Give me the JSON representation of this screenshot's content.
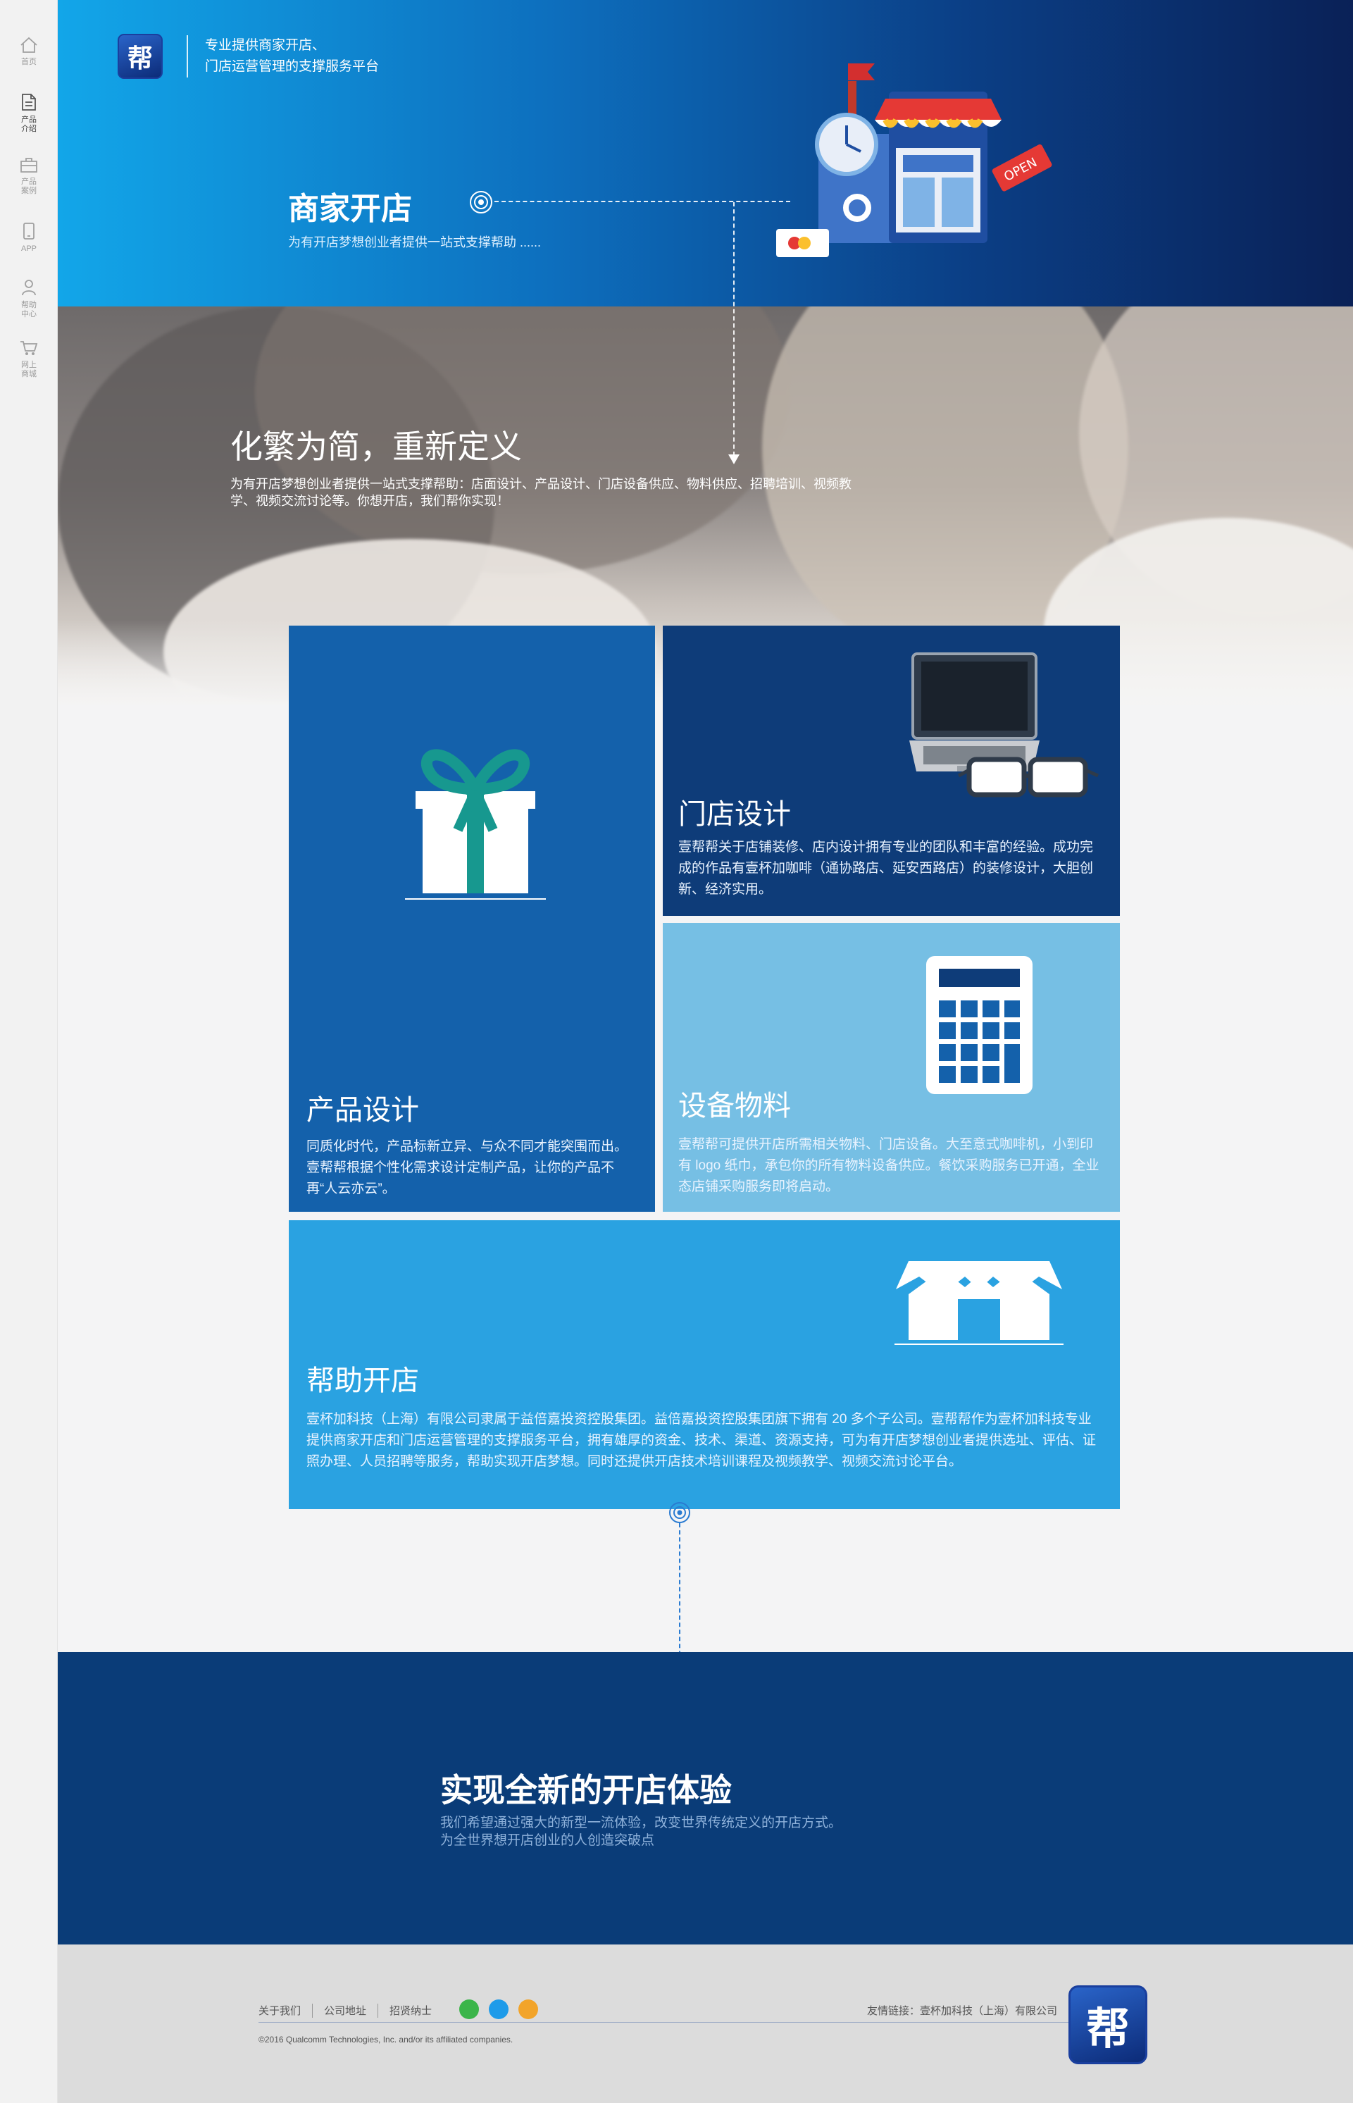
{
  "sidebar": {
    "items": [
      {
        "label": "首页",
        "icon": "home-icon"
      },
      {
        "label": "产品介绍",
        "icon": "document-icon"
      },
      {
        "label": "产品案例",
        "icon": "briefcase-icon"
      },
      {
        "label": "APP",
        "icon": "mobile-icon"
      },
      {
        "label": "帮助中心",
        "icon": "user-icon"
      },
      {
        "label": "网上商城",
        "icon": "cart-icon"
      }
    ]
  },
  "header": {
    "logo_char": "帮",
    "tagline_line1": "专业提供商家开店、",
    "tagline_line2": "门店运营管理的支撑服务平台",
    "title": "商家开店",
    "subtitle": "为有开店梦想创业者提供一站式支撑帮助 ......",
    "illustration_icon": "shop-illustration-icon"
  },
  "banner": {
    "title": "化繁为简，重新定义",
    "text": "为有开店梦想创业者提供一站式支撑帮助：店面设计、产品设计、门店设备供应、物料供应、招聘培训、视频教学、视频交流讨论等。你想开店，我们帮你实现！"
  },
  "tiles": {
    "product": {
      "title": "产品设计",
      "desc": "同质化时代，产品标新立异、与众不同才能突围而出。壹帮帮根据个性化需求设计定制产品，让你的产品不再“人云亦云”。",
      "icon": "gift-icon"
    },
    "store": {
      "title": "门店设计",
      "desc": "壹帮帮关于店铺装修、店内设计拥有专业的团队和丰富的经验。成功完成的作品有壹杯加咖啡（通协路店、延安西路店）的装修设计，大胆创新、经济实用。",
      "icon": "laptop-glasses-icon"
    },
    "equip": {
      "title": "设备物料",
      "desc": "壹帮帮可提供开店所需相关物料、门店设备。大至意式咖啡机，小到印有 logo 纸巾，承包你的所有物料设备供应。餐饮采购服务已开通，全业态店铺采购服务即将启动。",
      "icon": "calculator-icon"
    },
    "help": {
      "title": "帮助开店",
      "desc": "壹杯加科技（上海）有限公司隶属于益倍嘉投资控股集团。益倍嘉投资控股集团旗下拥有 20 多个子公司。壹帮帮作为壹杯加科技专业提供商家开店和门店运营管理的支撑服务平台，拥有雄厚的资金、技术、渠道、资源支持，可为有开店梦想创业者提供选址、评估、证照办理、人员招聘等服务，帮助实现开店梦想。同时还提供开店技术培训课程及视频教学、视频交流讨论平台。",
      "icon": "shop-house-icon"
    }
  },
  "experience": {
    "title": "实现全新的开店体验",
    "line1": "我们希望通过强大的新型一流体验，改变世界传统定义的开店方式。",
    "line2": "为全世界想开店创业的人创造突破点"
  },
  "footer": {
    "links": [
      "关于我们",
      "公司地址",
      "招贤纳士"
    ],
    "social": [
      {
        "name": "wechat-icon",
        "color": "#3bb54a"
      },
      {
        "name": "qq-icon",
        "color": "#1e9be9"
      },
      {
        "name": "weibo-icon",
        "color": "#f2a42a"
      }
    ],
    "friend_link": "友情链接：壹杯加科技（上海）有限公司",
    "copyright": "©2016 Qualcomm Technologies, Inc. and/or its affiliated companies.",
    "logo_char": "帮"
  },
  "colors": {
    "hero_start": "#12a6e9",
    "hero_end": "#0a2157",
    "tile_product": "#1461ab",
    "tile_store": "#0e3c79",
    "tile_equip": "#76bfe4",
    "tile_help": "#2aa2e1",
    "experience_bg": "#0a3c78"
  }
}
